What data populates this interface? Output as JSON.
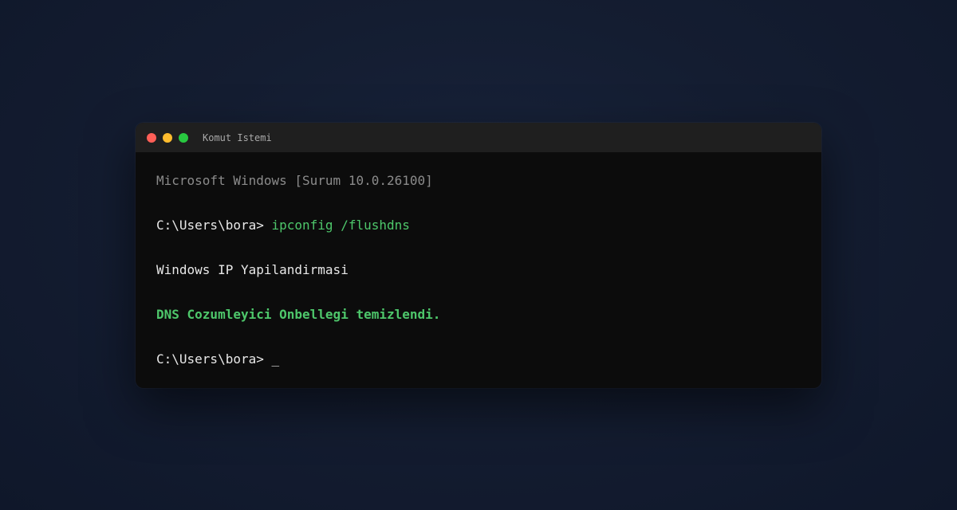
{
  "window": {
    "title": "Komut Istemi"
  },
  "terminal": {
    "banner": "Microsoft Windows [Surum 10.0.26100]",
    "prompt1": "C:\\Users\\bora> ",
    "command1": "ipconfig /flushdns",
    "output_header": "Windows IP Yapilandirmasi",
    "output_result": "DNS Cozumleyici Onbellegi temizlendi.",
    "prompt2": "C:\\Users\\bora> ",
    "cursor": "_"
  },
  "colors": {
    "background": "#141d31",
    "window_bg": "#0c0c0c",
    "titlebar_bg": "#1f1f1f",
    "close_dot": "#ff5f57",
    "minimize_dot": "#febc2e",
    "maximize_dot": "#28c840",
    "command_green": "#4ec76b"
  }
}
